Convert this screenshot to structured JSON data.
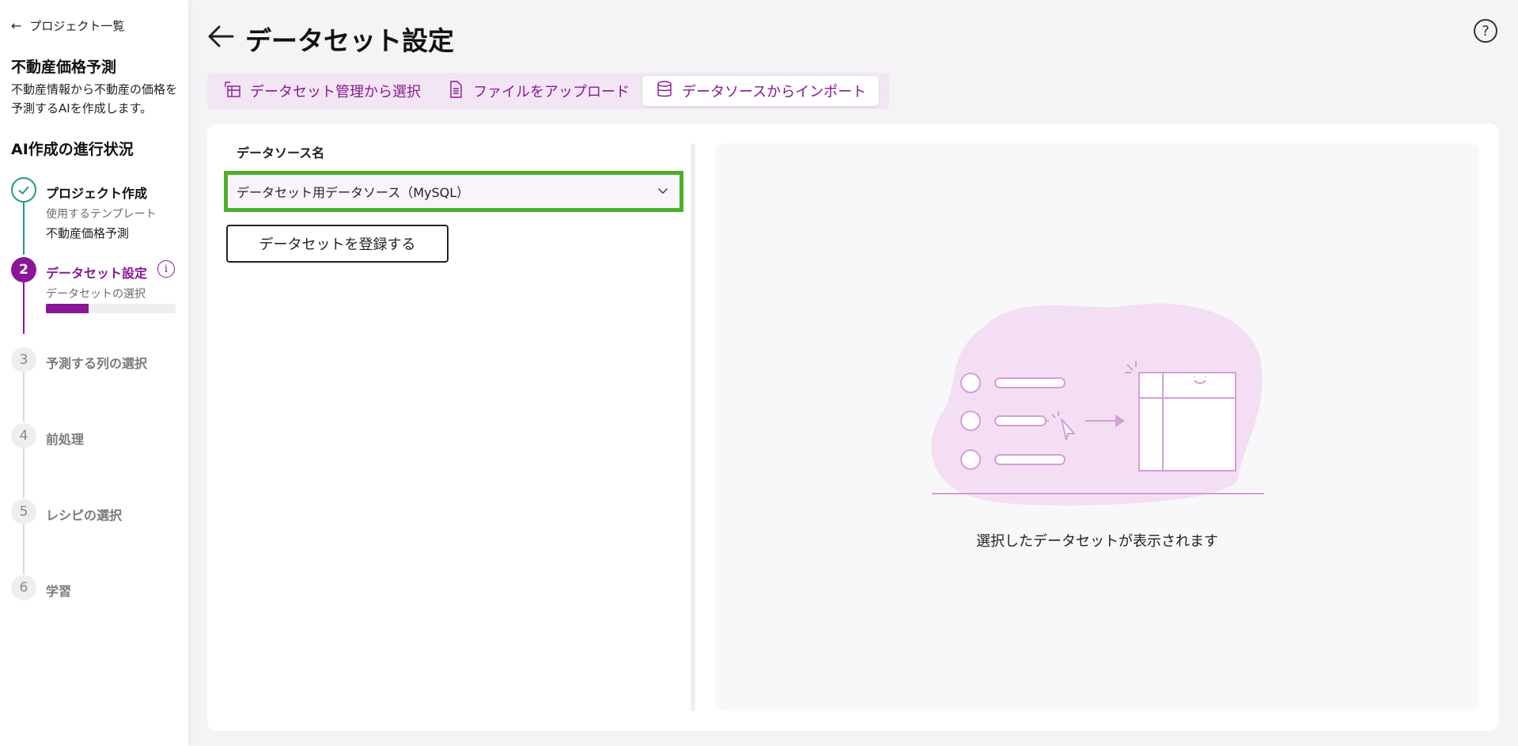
{
  "sidebar": {
    "back_label": "プロジェクト一覧",
    "project_title": "不動産価格予測",
    "project_desc": "不動産情報から不動産の価格を予測するAIを作成します。",
    "progress_title": "AI作成の進行状況",
    "steps": [
      {
        "number": "1",
        "label": "プロジェクト作成",
        "sub": "使用するテンプレート",
        "value": "不動産価格予測",
        "state": "done"
      },
      {
        "number": "2",
        "label": "データセット設定",
        "sub": "データセットの選択",
        "progress": 0.33,
        "state": "active"
      },
      {
        "number": "3",
        "label": "予測する列の選択",
        "state": "todo"
      },
      {
        "number": "4",
        "label": "前処理",
        "state": "todo"
      },
      {
        "number": "5",
        "label": "レシピの選択",
        "state": "todo"
      },
      {
        "number": "6",
        "label": "学習",
        "state": "todo"
      }
    ]
  },
  "header": {
    "title": "データセット設定"
  },
  "tabs": [
    {
      "label": "データセット管理から選択",
      "icon": "dataset-manage-icon",
      "active": false
    },
    {
      "label": "ファイルをアップロード",
      "icon": "file-icon",
      "active": false
    },
    {
      "label": "データソースからインポート",
      "icon": "database-icon",
      "active": true
    }
  ],
  "form": {
    "field_label": "データソース名",
    "selected_value": "データセット用データソース（MySQL）",
    "register_label": "データセットを登録する"
  },
  "preview": {
    "empty_message": "選択したデータセットが表示されます"
  },
  "colors": {
    "accent": "#8a1696",
    "done": "#1d9a8a",
    "focus_border": "#4caf28"
  }
}
